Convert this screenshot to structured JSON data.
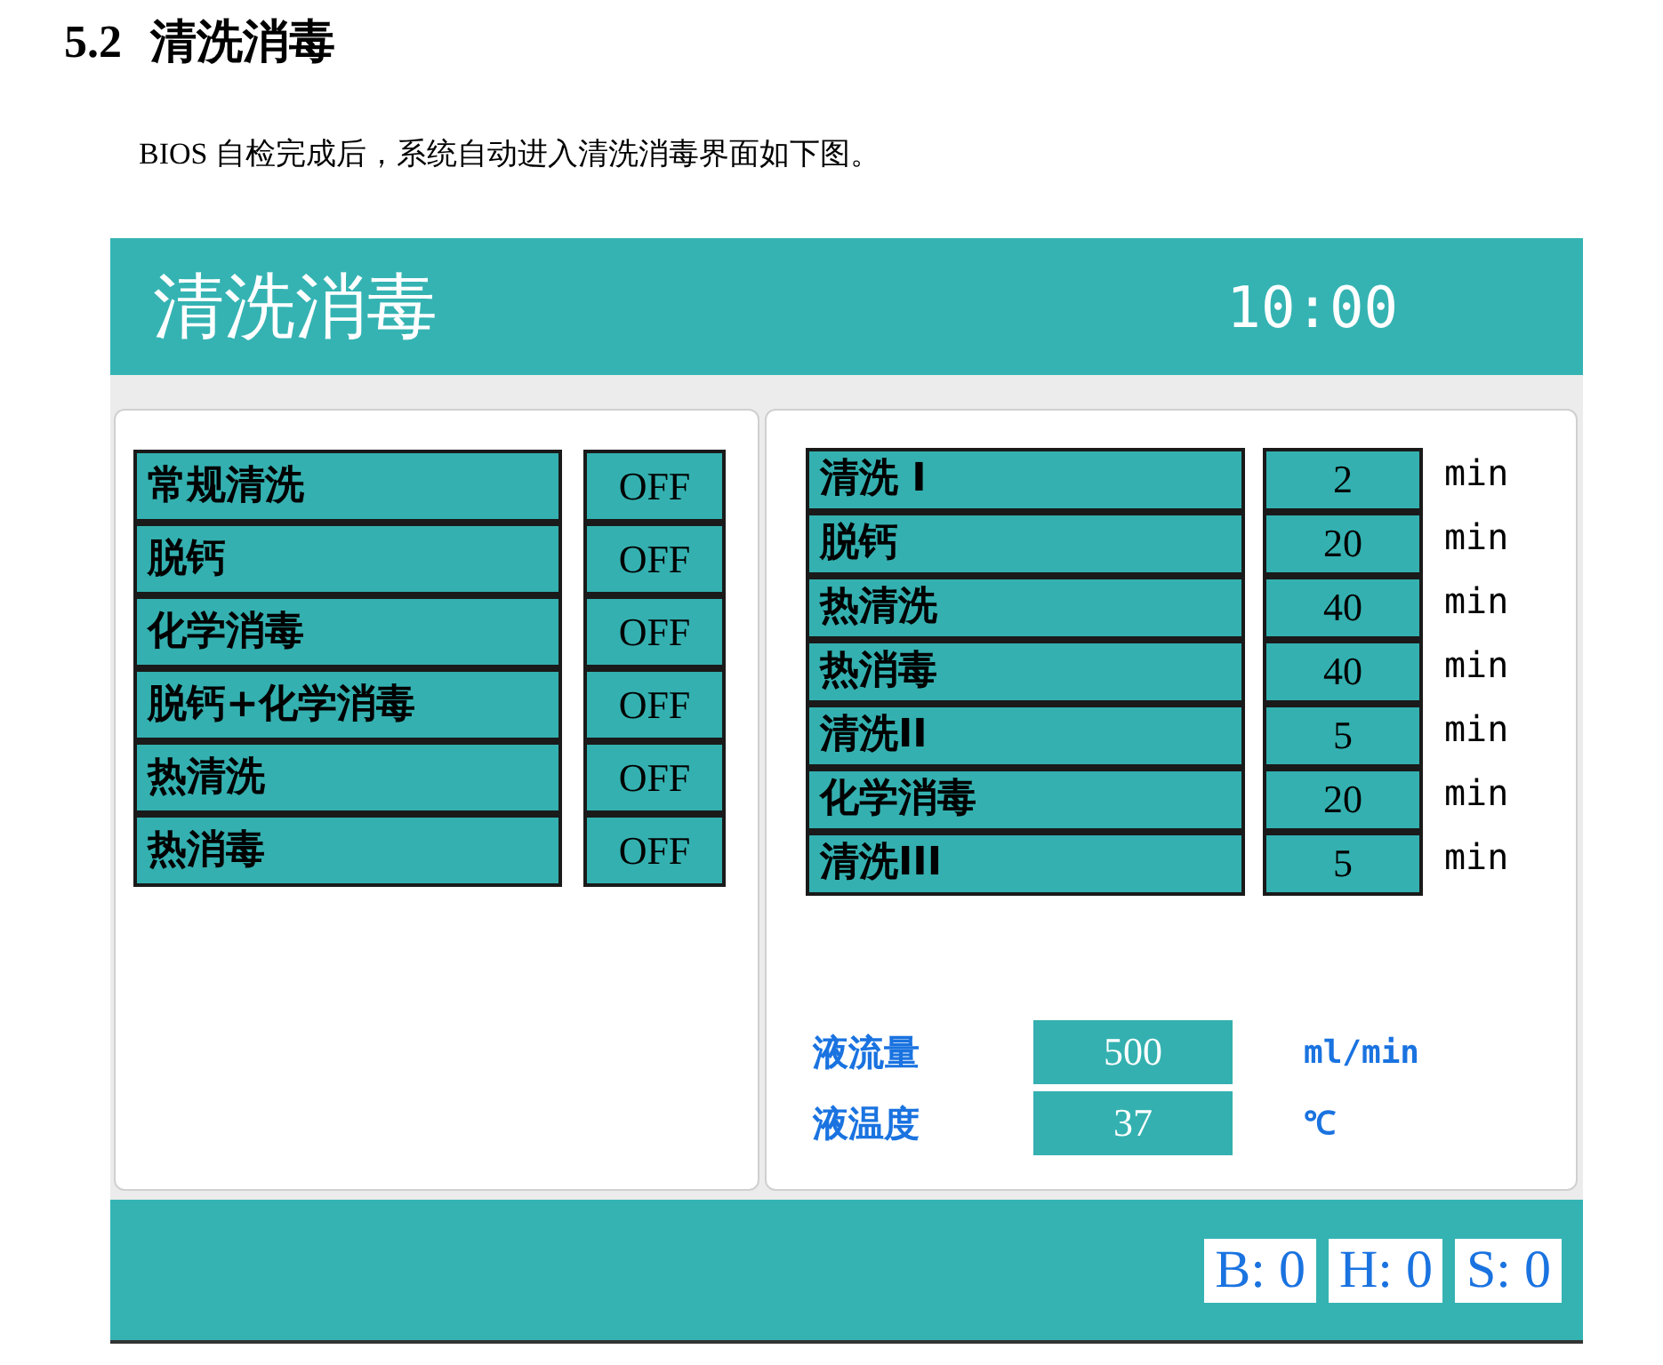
{
  "section": {
    "number": "5.2",
    "title": "清洗消毒"
  },
  "intro": "BIOS 自检完成后，系统自动进入清洗消毒界面如下图。",
  "screen": {
    "title": "清洗消毒",
    "time": "10:00",
    "programs": [
      {
        "label": "常规清洗",
        "state": "OFF"
      },
      {
        "label": "脱钙",
        "state": "OFF"
      },
      {
        "label": "化学消毒",
        "state": "OFF"
      },
      {
        "label": "脱钙+化学消毒",
        "state": "OFF"
      },
      {
        "label": "热清洗",
        "state": "OFF"
      },
      {
        "label": "热消毒",
        "state": "OFF"
      }
    ],
    "durations": [
      {
        "label": "清洗 I",
        "value": "2",
        "unit": "min"
      },
      {
        "label": "脱钙",
        "value": "20",
        "unit": "min"
      },
      {
        "label": "热清洗",
        "value": "40",
        "unit": "min"
      },
      {
        "label": "热消毒",
        "value": "40",
        "unit": "min"
      },
      {
        "label": "清洗II",
        "value": "5",
        "unit": "min"
      },
      {
        "label": "化学消毒",
        "value": "20",
        "unit": "min"
      },
      {
        "label": "清洗III",
        "value": "5",
        "unit": "min"
      }
    ],
    "parameters": [
      {
        "label": "液流量",
        "value": "500",
        "unit": "ml/min"
      },
      {
        "label": "液温度",
        "value": "37",
        "unit": "℃"
      }
    ],
    "status": [
      "B: 0",
      "H: 0",
      "S: 0"
    ]
  }
}
